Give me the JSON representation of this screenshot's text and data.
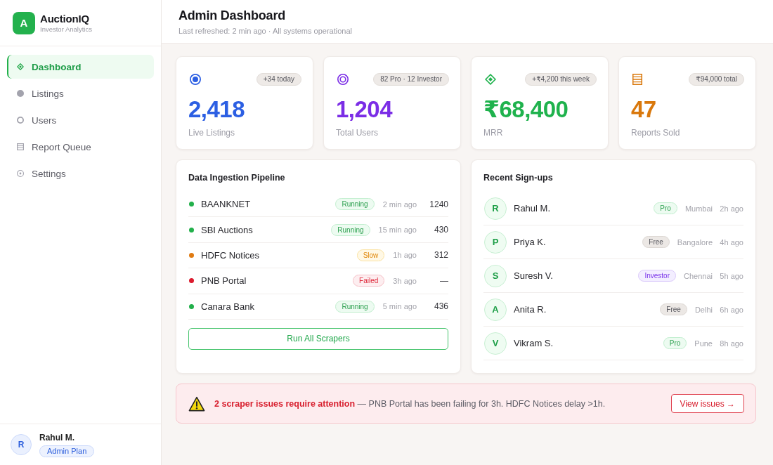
{
  "brand": {
    "logo_letter": "A",
    "name": "AuctionIQ",
    "tagline": "Investor Analytics"
  },
  "sidebar": {
    "items": [
      {
        "label": "Dashboard",
        "selected": true
      },
      {
        "label": "Listings",
        "selected": false
      },
      {
        "label": "Users",
        "selected": false
      },
      {
        "label": "Report Queue",
        "selected": false
      },
      {
        "label": "Settings",
        "selected": false
      }
    ],
    "user": {
      "initial": "R",
      "name": "Rahul M.",
      "plan": "Admin Plan"
    }
  },
  "header": {
    "title": "Admin Dashboard",
    "subtitle": "Last refreshed: 2 min ago · All systems operational"
  },
  "stats": [
    {
      "badge": "+34 today",
      "value": "2,418",
      "label": "Live Listings",
      "color": "#2c5fe3"
    },
    {
      "badge": "82 Pro · 12 Investor",
      "value": "1,204",
      "label": "Total Users",
      "color": "#7b2de6"
    },
    {
      "badge": "+₹4,200 this week",
      "value": "₹68,400",
      "label": "MRR",
      "color": "#1fb24d"
    },
    {
      "badge": "₹94,000 total",
      "value": "47",
      "label": "Reports Sold",
      "color": "#d9780c"
    }
  ],
  "pipeline": {
    "title": "Data Ingestion Pipeline",
    "sources": [
      {
        "name": "BAANKNET",
        "kind": "running",
        "status": "Running",
        "time": "2 min ago",
        "count": "1240"
      },
      {
        "name": "SBI Auctions",
        "kind": "running",
        "status": "Running",
        "time": "15 min ago",
        "count": "430"
      },
      {
        "name": "HDFC Notices",
        "kind": "slow",
        "status": "Slow",
        "time": "1h ago",
        "count": "312"
      },
      {
        "name": "PNB Portal",
        "kind": "failed",
        "status": "Failed",
        "time": "3h ago",
        "count": "—"
      },
      {
        "name": "Canara Bank",
        "kind": "running",
        "status": "Running",
        "time": "5 min ago",
        "count": "436"
      }
    ],
    "button": "Run All Scrapers"
  },
  "signups": {
    "title": "Recent Sign-ups",
    "users": [
      {
        "initial": "R",
        "name": "Rahul M.",
        "kind": "pro",
        "plan": "Pro",
        "city": "Mumbai",
        "time": "2h ago"
      },
      {
        "initial": "P",
        "name": "Priya K.",
        "kind": "free",
        "plan": "Free",
        "city": "Bangalore",
        "time": "4h ago"
      },
      {
        "initial": "S",
        "name": "Suresh V.",
        "kind": "investor",
        "plan": "Investor",
        "city": "Chennai",
        "time": "5h ago"
      },
      {
        "initial": "A",
        "name": "Anita R.",
        "kind": "free",
        "plan": "Free",
        "city": "Delhi",
        "time": "6h ago"
      },
      {
        "initial": "V",
        "name": "Vikram S.",
        "kind": "pro",
        "plan": "Pro",
        "city": "Pune",
        "time": "8h ago"
      }
    ]
  },
  "alert": {
    "message": "**2 scraper issues require attention** — PNB Portal has been failing for 3h. HDFC Notices delay >1h.",
    "action": "View issues →"
  }
}
